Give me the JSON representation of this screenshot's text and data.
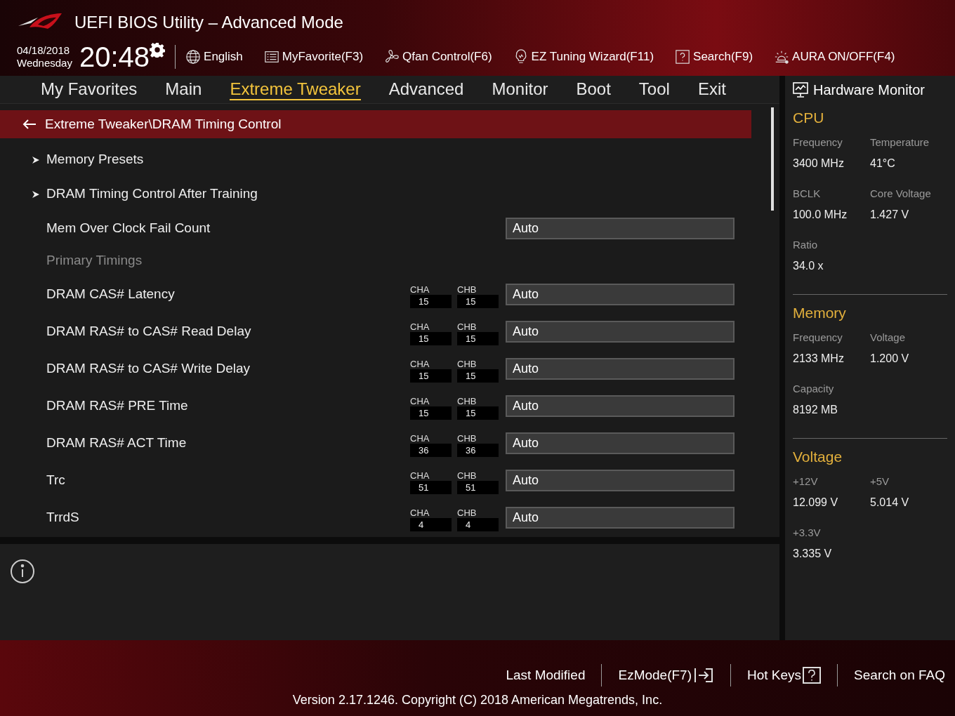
{
  "header": {
    "title": "UEFI BIOS Utility – Advanced Mode",
    "date": "04/18/2018",
    "weekday": "Wednesday",
    "time": "20:48",
    "toolbar": [
      {
        "kind": "language",
        "label": "English"
      },
      {
        "kind": "favorite",
        "label": "MyFavorite(F3)"
      },
      {
        "kind": "fan",
        "label": "Qfan Control(F6)"
      },
      {
        "kind": "wizard",
        "label": "EZ Tuning Wizard(F11)"
      },
      {
        "kind": "search",
        "label": "Search(F9)"
      },
      {
        "kind": "aura",
        "label": "AURA ON/OFF(F4)"
      }
    ]
  },
  "tabs": [
    {
      "label": "My Favorites",
      "selected": false
    },
    {
      "label": "Main",
      "selected": false
    },
    {
      "label": "Extreme Tweaker",
      "selected": true
    },
    {
      "label": "Advanced",
      "selected": false
    },
    {
      "label": "Monitor",
      "selected": false
    },
    {
      "label": "Boot",
      "selected": false
    },
    {
      "label": "Tool",
      "selected": false
    },
    {
      "label": "Exit",
      "selected": false
    }
  ],
  "breadcrumb": {
    "label": "Extreme Tweaker\\DRAM Timing Control",
    "selected": true
  },
  "settings": [
    {
      "kind": "submenu",
      "label": "Memory Presets"
    },
    {
      "kind": "submenu",
      "label": "DRAM Timing Control After Training"
    },
    {
      "kind": "setting",
      "label": "Mem Over Clock Fail Count",
      "value": "Auto"
    },
    {
      "kind": "heading",
      "label": "Primary Timings"
    },
    {
      "kind": "timing",
      "label": "DRAM CAS# Latency",
      "cha_label": "CHA",
      "cha": "15",
      "chb_label": "CHB",
      "chb": "15",
      "value": "Auto"
    },
    {
      "kind": "timing",
      "label": "DRAM RAS# to CAS# Read Delay",
      "cha_label": "CHA",
      "cha": "15",
      "chb_label": "CHB",
      "chb": "15",
      "value": "Auto"
    },
    {
      "kind": "timing",
      "label": "DRAM RAS# to CAS# Write Delay",
      "cha_label": "CHA",
      "cha": "15",
      "chb_label": "CHB",
      "chb": "15",
      "value": "Auto"
    },
    {
      "kind": "timing",
      "label": "DRAM RAS# PRE Time",
      "cha_label": "CHA",
      "cha": "15",
      "chb_label": "CHB",
      "chb": "15",
      "value": "Auto"
    },
    {
      "kind": "timing",
      "label": "DRAM RAS# ACT Time",
      "cha_label": "CHA",
      "cha": "36",
      "chb_label": "CHB",
      "chb": "36",
      "value": "Auto"
    },
    {
      "kind": "timing",
      "label": "Trc",
      "cha_label": "CHA",
      "cha": "51",
      "chb_label": "CHB",
      "chb": "51",
      "value": "Auto"
    },
    {
      "kind": "timing",
      "label": "TrrdS",
      "cha_label": "CHA",
      "cha": "4",
      "chb_label": "CHB",
      "chb": "4",
      "value": "Auto"
    }
  ],
  "hardware_monitor": {
    "title": "Hardware Monitor",
    "sections": [
      {
        "title": "CPU",
        "items": [
          {
            "label": "Frequency",
            "value": "3400 MHz"
          },
          {
            "label": "Temperature",
            "value": "41°C"
          },
          {
            "label": "BCLK",
            "value": "100.0 MHz"
          },
          {
            "label": "Core Voltage",
            "value": "1.427 V"
          },
          {
            "label": "Ratio",
            "value": "34.0 x"
          }
        ]
      },
      {
        "title": "Memory",
        "items": [
          {
            "label": "Frequency",
            "value": "2133 MHz"
          },
          {
            "label": "Voltage",
            "value": "1.200 V"
          },
          {
            "label": "Capacity",
            "value": "8192 MB"
          }
        ]
      },
      {
        "title": "Voltage",
        "items": [
          {
            "label": "+12V",
            "value": "12.099 V"
          },
          {
            "label": "+5V",
            "value": "5.014 V"
          },
          {
            "label": "+3.3V",
            "value": "3.335 V"
          }
        ]
      }
    ]
  },
  "footer": {
    "links": [
      {
        "kind": "plain",
        "label": "Last Modified"
      },
      {
        "kind": "exit",
        "label": "EzMode(F7)"
      },
      {
        "kind": "help",
        "label": "Hot Keys"
      },
      {
        "kind": "plain",
        "label": "Search on FAQ"
      }
    ],
    "version": "Version 2.17.1246. Copyright (C) 2018 American Megatrends, Inc."
  }
}
